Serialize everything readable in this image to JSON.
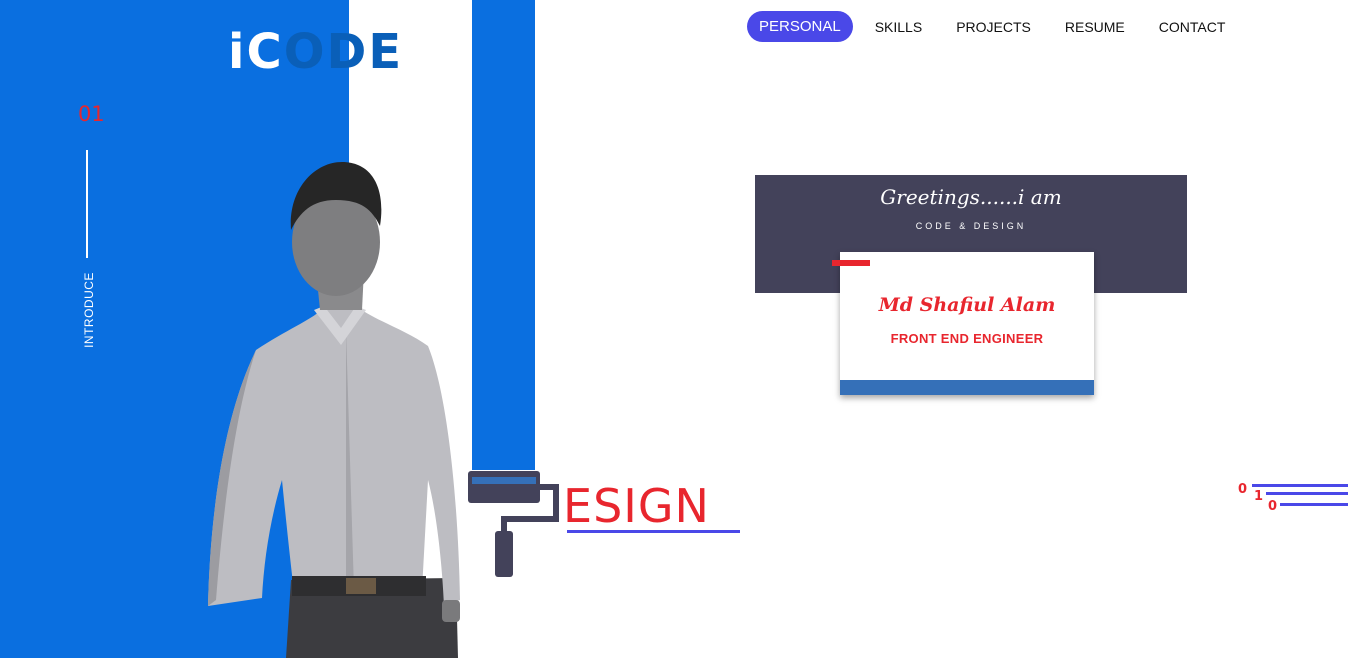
{
  "hero": {
    "title_part1": "iC",
    "title_part2": "ODE",
    "title_part3": "&"
  },
  "side": {
    "section_number": "01",
    "section_label": "INTRODUCE"
  },
  "nav": {
    "items": [
      {
        "label": "PERSONAL",
        "active": true
      },
      {
        "label": "SKILLS"
      },
      {
        "label": "PROJECTS"
      },
      {
        "label": "RESUME"
      },
      {
        "label": "CONTACT"
      }
    ]
  },
  "greeting": {
    "script": "Greetings......i am",
    "sub": "CODE & DESIGN"
  },
  "card": {
    "name": "Md Shafiul Alam",
    "role": "FRONT END ENGINEER"
  },
  "design_text": "ESIGN",
  "binary": {
    "digits": [
      "0",
      "1",
      "0"
    ]
  },
  "colors": {
    "primary_blue": "#0a6fe0",
    "accent_red": "#e8262e",
    "nav_active": "#4a48e8",
    "banner_dark": "#43425a"
  }
}
